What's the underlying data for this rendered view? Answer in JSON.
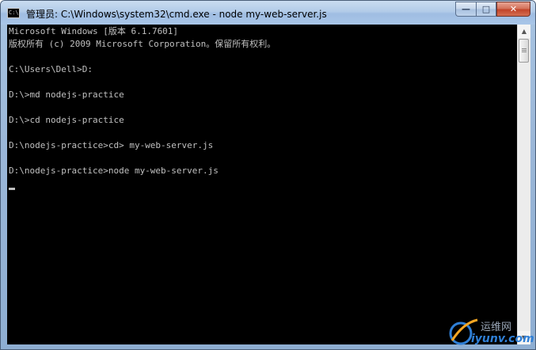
{
  "window": {
    "icon_text": "C:\\",
    "title": "管理员: C:\\Windows\\system32\\cmd.exe - node  my-web-server.js",
    "controls": {
      "minimize": "—",
      "maximize": "□",
      "close": "✕"
    }
  },
  "console": {
    "lines": [
      "Microsoft Windows [版本 6.1.7601]",
      "版权所有 (c) 2009 Microsoft Corporation。保留所有权利。",
      "",
      "C:\\Users\\Dell>D:",
      "",
      "D:\\>md nodejs-practice",
      "",
      "D:\\>cd nodejs-practice",
      "",
      "D:\\nodejs-practice>cd> my-web-server.js",
      "",
      "D:\\nodejs-practice>node my-web-server.js"
    ],
    "text_color": "#c0c0c0",
    "background": "#000000"
  },
  "scrollbar": {
    "up_arrow": "▲",
    "down_arrow": "▼"
  },
  "watermark": {
    "chinese": "运维网",
    "domain": "iyunv.com"
  }
}
